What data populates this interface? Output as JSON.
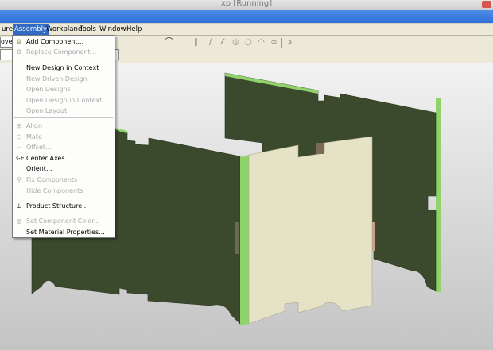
{
  "window": {
    "title": "xp [Running]"
  },
  "menubar": {
    "items": [
      {
        "label": "ure"
      },
      {
        "label": "Assembly"
      },
      {
        "label": "Workplane"
      },
      {
        "label": "Tools"
      },
      {
        "label": "Window"
      },
      {
        "label": "Help"
      }
    ]
  },
  "toolbar": {
    "left_combo_text": "ove C"
  },
  "assembly_menu": {
    "items": [
      {
        "label": "Add Component...",
        "enabled": true,
        "icon": "add-component-icon"
      },
      {
        "label": "Replace Component...",
        "enabled": false,
        "icon": "replace-component-icon"
      },
      {
        "label": "New Design in Context",
        "enabled": true
      },
      {
        "label": "New Driven Design",
        "enabled": false
      },
      {
        "label": "Open Designs",
        "enabled": false
      },
      {
        "label": "Open Design in Context",
        "enabled": false
      },
      {
        "label": "Open Layout",
        "enabled": false
      },
      {
        "label": "Align",
        "enabled": false,
        "icon": "align-icon"
      },
      {
        "label": "Mate",
        "enabled": false,
        "icon": "mate-icon"
      },
      {
        "label": "Offset...",
        "enabled": false,
        "icon": "offset-icon"
      },
      {
        "label": "Center Axes",
        "enabled": true,
        "icon": "center-axes-icon",
        "icon_text": "3-E"
      },
      {
        "label": "Orient...",
        "enabled": true
      },
      {
        "label": "Fix Components",
        "enabled": false,
        "icon": "fix-components-icon"
      },
      {
        "label": "Hide Components",
        "enabled": false
      },
      {
        "label": "Product Structure...",
        "enabled": true,
        "icon": "product-structure-icon"
      },
      {
        "label": "Set Component Color...",
        "enabled": false,
        "icon": "color-icon"
      },
      {
        "label": "Set Material Properties...",
        "enabled": true
      }
    ]
  },
  "colors": {
    "menu_highlight": "#316ac5",
    "panel_dark_green": "#3b4a2c",
    "panel_edge_green": "#8fd36a",
    "panel_cream": "#e6e2c6"
  }
}
